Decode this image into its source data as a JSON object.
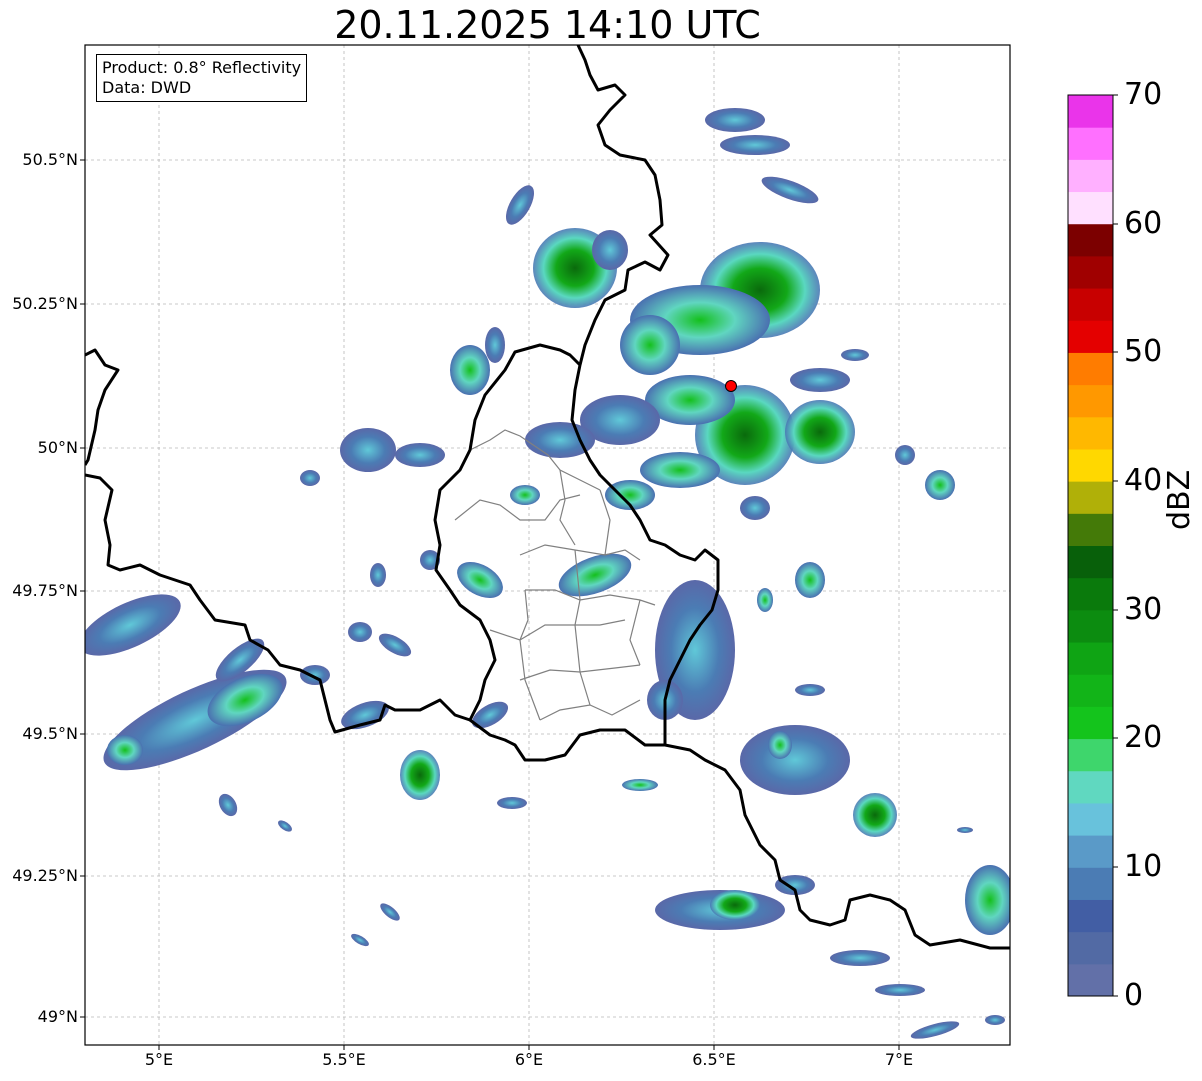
{
  "title": "20.11.2025 14:10 UTC",
  "info_box": {
    "product": "Product: 0.8° Reflectivity",
    "source": "Data: DWD"
  },
  "lat_labels": [
    "50.5°N",
    "50.25°N",
    "50°N",
    "49.75°N",
    "49.5°N",
    "49.25°N",
    "49°N"
  ],
  "lon_labels": [
    "5°E",
    "5.5°E",
    "6°E",
    "6.5°E",
    "7°E"
  ],
  "colorbar": {
    "label": "dBZ",
    "ticks": [
      "70",
      "60",
      "50",
      "40",
      "30",
      "20",
      "10",
      "0"
    ],
    "colors": [
      "#6270a8",
      "#526aa4",
      "#425ea4",
      "#4b7cb4",
      "#5a9ac8",
      "#68c2dc",
      "#60d8c0",
      "#3ed66c",
      "#14c41c",
      "#12b418",
      "#0fa414",
      "#0c8c10",
      "#0a7a0c",
      "#08600a",
      "#447a08",
      "#b0b008",
      "#ffd800",
      "#ffb800",
      "#ff9800",
      "#ff7c00",
      "#e40000",
      "#c80000",
      "#a00000",
      "#7c0000",
      "#ffe0ff",
      "#ffb0ff",
      "#ff70ff",
      "#ea34ea"
    ]
  },
  "map": {
    "lon_range": [
      4.8,
      7.3
    ],
    "lat_range": [
      48.95,
      50.69
    ],
    "radar_site": {
      "lon": 6.548,
      "lat": 50.109,
      "color": "#ff0000"
    },
    "border_color": "#000000",
    "admin_color": "#808080",
    "grid": true
  }
}
